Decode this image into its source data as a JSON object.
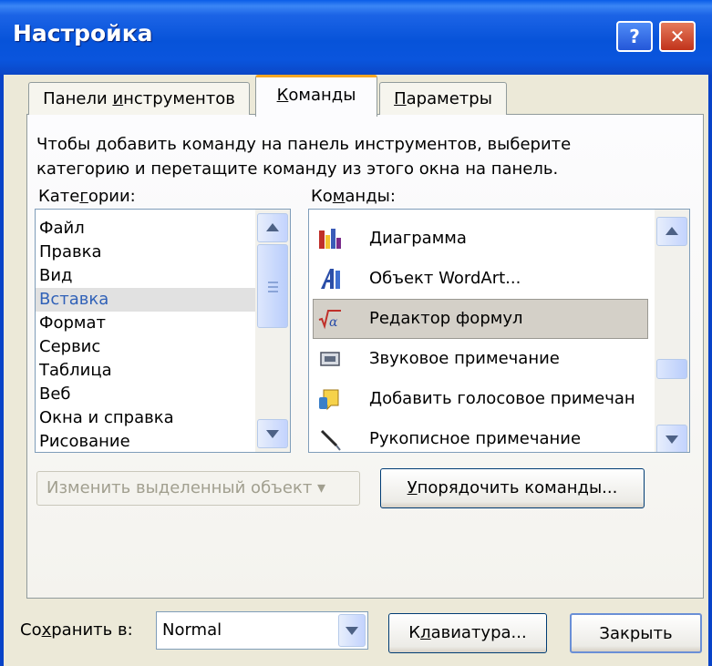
{
  "window": {
    "title": "Настройка",
    "help_glyph": "?",
    "close_glyph": "✕"
  },
  "tabs": [
    {
      "pre": "Панели ",
      "accel": "и",
      "post": "нструментов",
      "selected": false
    },
    {
      "pre": "",
      "accel": "К",
      "post": "оманды",
      "selected": true
    },
    {
      "pre": "",
      "accel": "П",
      "post": "араметры",
      "selected": false
    }
  ],
  "description": {
    "line1": "Чтобы добавить команду на панель инструментов, выберите",
    "line2": "категорию и перетащите команду из этого окна на панель."
  },
  "categories": {
    "label_pre": "Кате",
    "label_accel": "г",
    "label_post": "ории:",
    "items": [
      "Файл",
      "Правка",
      "Вид",
      "Вставка",
      "Формат",
      "Сервис",
      "Таблица",
      "Веб",
      "Окна и справка",
      "Рисование"
    ],
    "selected": "Вставка"
  },
  "commands": {
    "label_pre": "Ко",
    "label_accel": "м",
    "label_post": "анды:",
    "items": [
      {
        "label": "Диаграмма",
        "icon": "chart-icon"
      },
      {
        "label": "Объект WordArt...",
        "icon": "wordart-icon"
      },
      {
        "label": "Редактор формул",
        "icon": "equation-icon"
      },
      {
        "label": "Звуковое примечание",
        "icon": "sound-note-icon"
      },
      {
        "label": "Добавить голосовое примечан",
        "icon": "voice-note-icon"
      },
      {
        "label": "Рукописное примечание",
        "icon": "pen-note-icon"
      }
    ],
    "selected": "Редактор формул"
  },
  "buttons": {
    "modify": "Изменить выделенный объект ▾",
    "arrange_accel": "У",
    "arrange_post": "порядочить команды...",
    "keyboard_pre": "К",
    "keyboard_accel": "л",
    "keyboard_post": "авиатура...",
    "close": "Закрыть"
  },
  "save": {
    "label_pre": "Со",
    "label_accel": "х",
    "label_post": "ранить в:",
    "value": "Normal"
  },
  "colors": {
    "titlebar": "#0753d9",
    "dialog_bg": "#ece9d8",
    "selection_text": "#3061b8",
    "active_tab_accent": "#f5a623"
  }
}
